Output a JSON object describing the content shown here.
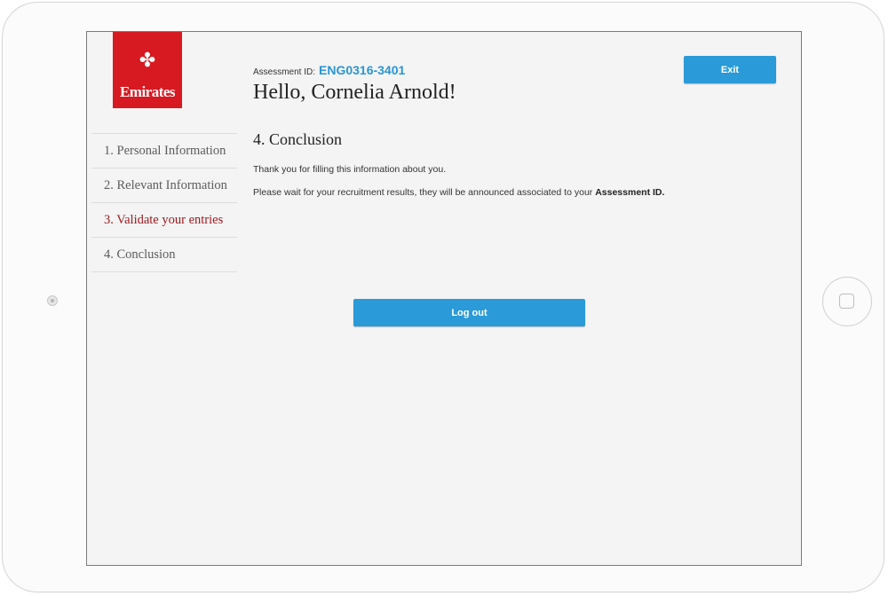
{
  "brand": {
    "name": "Emirates",
    "color": "#d71921"
  },
  "header": {
    "assessment_label": "Assessment ID:",
    "assessment_id": "ENG0316-3401",
    "greeting": "Hello, Cornelia Arnold!",
    "exit_label": "Exit"
  },
  "sidebar": {
    "items": [
      {
        "label": "1. Personal Information"
      },
      {
        "label": "2. Relevant Information"
      },
      {
        "label": "3. Validate your entries"
      },
      {
        "label": "4. Conclusion"
      }
    ]
  },
  "main": {
    "section_title": "4. Conclusion",
    "message_1": "Thank you for filling this information about you.",
    "message_2_prefix": "Please wait for your recruitment results, they will be announced associated to your ",
    "message_2_bold": "Assessment ID.",
    "logout_label": "Log out"
  },
  "colors": {
    "accent": "#2a9ad8",
    "active_nav": "#a01820"
  }
}
